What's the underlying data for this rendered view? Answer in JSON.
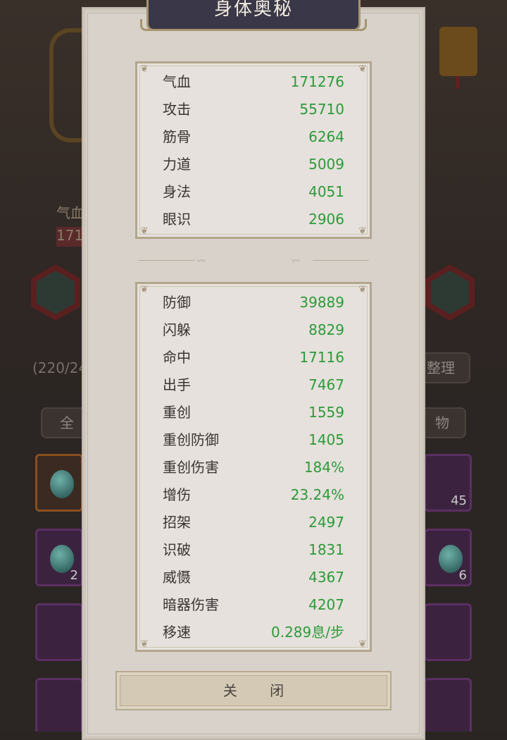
{
  "modal": {
    "title": "身体奥秘",
    "close_label": "关 闭"
  },
  "primary_stats": [
    {
      "label": "气血",
      "value": "171276"
    },
    {
      "label": "攻击",
      "value": "55710"
    },
    {
      "label": "筋骨",
      "value": "6264"
    },
    {
      "label": "力道",
      "value": "5009"
    },
    {
      "label": "身法",
      "value": "4051"
    },
    {
      "label": "眼识",
      "value": "2906"
    }
  ],
  "secondary_stats": [
    {
      "label": "防御",
      "value": "39889"
    },
    {
      "label": "闪躲",
      "value": "8829"
    },
    {
      "label": "命中",
      "value": "17116"
    },
    {
      "label": "出手",
      "value": "7467"
    },
    {
      "label": "重创",
      "value": "1559"
    },
    {
      "label": "重创防御",
      "value": "1405"
    },
    {
      "label": "重创伤害",
      "value": "184%"
    },
    {
      "label": "增伤",
      "value": "23.24%"
    },
    {
      "label": "招架",
      "value": "2497"
    },
    {
      "label": "识破",
      "value": "1831"
    },
    {
      "label": "威慑",
      "value": "4367"
    },
    {
      "label": "暗器伤害",
      "value": "4207"
    },
    {
      "label": "移速",
      "value": "0.289息/步"
    }
  ],
  "background": {
    "hp_label_partial": "气血",
    "hp_value_partial": "171",
    "capacity_partial": "(220/24",
    "sort_button": "整理",
    "filter_all": "全",
    "filter_items": "物",
    "slot_counts": [
      "45",
      "6",
      "2"
    ]
  },
  "colors": {
    "value_green": "#2c9a3a",
    "modal_bg": "#d8d2cb",
    "title_plate": "#3a3848",
    "gold_border": "#a6956e"
  }
}
